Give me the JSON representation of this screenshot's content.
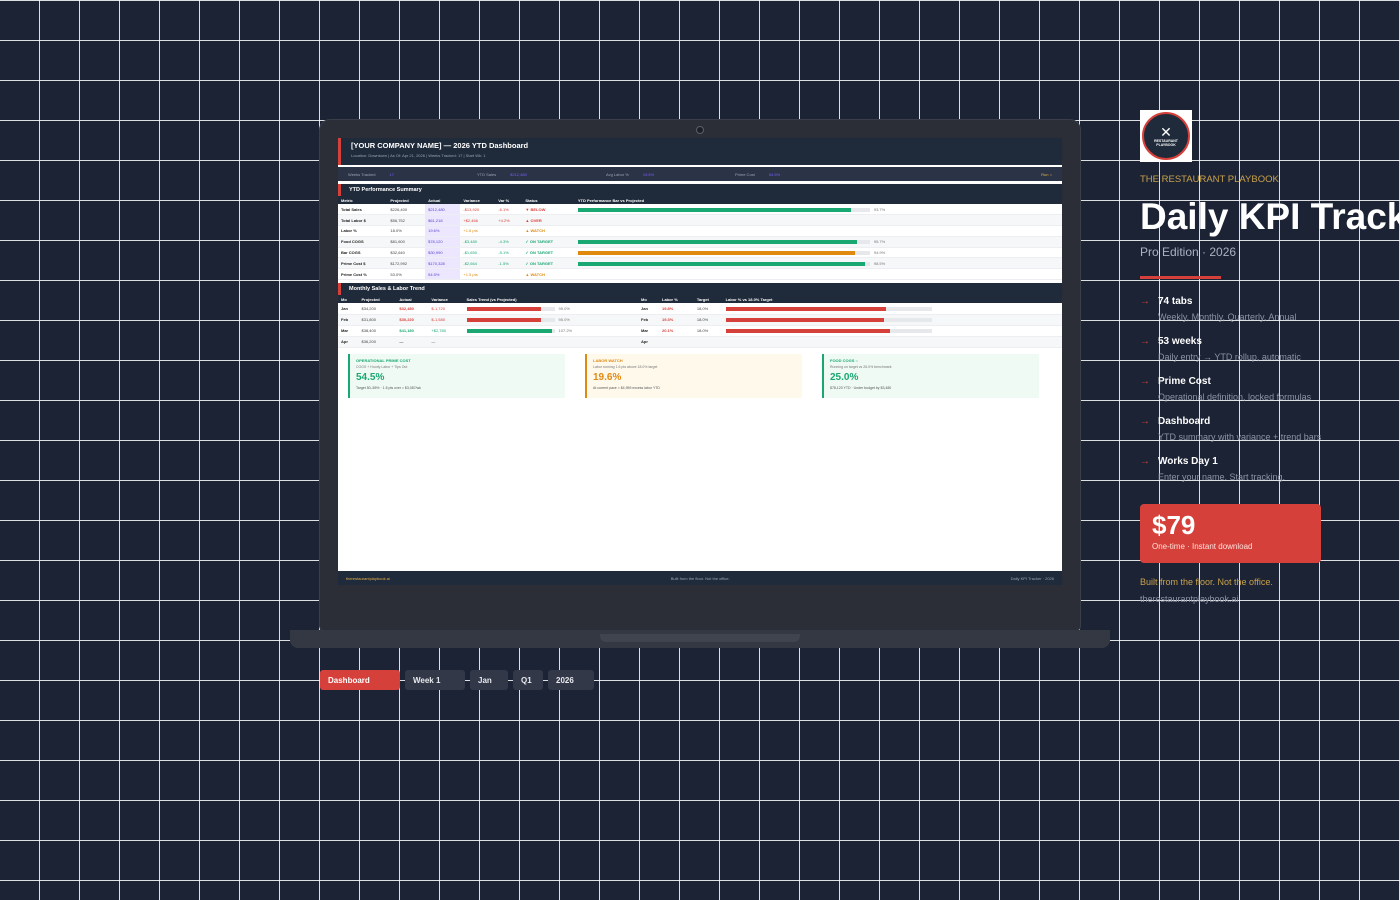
{
  "dashboard": {
    "title": "[YOUR COMPANY NAME]  —  2026 YTD Dashboard",
    "subtitle": "Location: Downtown  |  As Of: Apr 21, 2026  |  Weeks Tracked: 17  |  Start Wk: 1",
    "stats": [
      {
        "label": "Weeks Tracked",
        "value": "17"
      },
      {
        "label": "YTD Sales",
        "value": "$212,480"
      },
      {
        "label": "Avg Labor %",
        "value": "19.6%"
      },
      {
        "label": "Prime Cost",
        "value": "54.5%"
      }
    ],
    "stat_flag": "Run ○",
    "ytd_section": "YTD Performance Summary",
    "ytd_headers": [
      "Metric",
      "Projected",
      "Actual",
      "Variance",
      "Var %",
      "Status",
      "YTD Performance Bar vs Projected"
    ],
    "ytd_rows": [
      {
        "metric": "Total Sales",
        "projected": "$226,400",
        "actual": "$212,480",
        "variance": "-$13,920",
        "var_pct": "-6.1%",
        "status": "▼ BELOW",
        "bar_label": "93.7%",
        "bar": 0.937,
        "tone": "red",
        "bar_color": "#1aa872"
      },
      {
        "metric": "Total Labor $",
        "projected": "$56,752",
        "actual": "$61,218",
        "variance": "+$2,466",
        "var_pct": "+4.2%",
        "status": "▲ OVER",
        "bar_label": "",
        "bar": 0,
        "tone": "red",
        "bar_color": "#1aa872"
      },
      {
        "metric": "Labor %",
        "projected": "18.0%",
        "actual": "19.6%",
        "variance": "+1.6 pts",
        "var_pct": "",
        "status": "▲ WATCH",
        "bar_label": "",
        "bar": 0,
        "tone": "amber",
        "bar_color": "#1aa872"
      },
      {
        "metric": "Food COGS",
        "projected": "$81,600",
        "actual": "$78,120",
        "variance": "-$3,480",
        "var_pct": "-4.3%",
        "status": "✓ ON TARGET",
        "bar_label": "95.7%",
        "bar": 0.957,
        "tone": "green",
        "bar_color": "#1aa872"
      },
      {
        "metric": "Bar COGS",
        "projected": "$32,640",
        "actual": "$30,990",
        "variance": "-$1,650",
        "var_pct": "-5.1%",
        "status": "✓ ON TARGET",
        "bar_label": "94.9%",
        "bar": 0.949,
        "tone": "green",
        "bar_color": "#e08a10"
      },
      {
        "metric": "Prime Cost $",
        "projected": "$172,992",
        "actual": "$170,328",
        "variance": "-$2,664",
        "var_pct": "-1.5%",
        "status": "✓ ON TARGET",
        "bar_label": "98.5%",
        "bar": 0.985,
        "tone": "green",
        "bar_color": "#1aa872"
      },
      {
        "metric": "Prime Cost %",
        "projected": "53.0%",
        "actual": "54.5%",
        "variance": "+1.5 pts",
        "var_pct": "",
        "status": "▲ WATCH",
        "bar_label": "",
        "bar": 0,
        "tone": "amber",
        "bar_color": "#1aa872"
      }
    ],
    "monthly_section": "Monthly Sales & Labor Trend",
    "sales_headers": [
      "Mo",
      "Projected",
      "Actual",
      "Variance",
      "Sales Trend (vs Projected)"
    ],
    "sales_rows": [
      {
        "mo": "Jan",
        "projected": "$34,200",
        "actual": "$32,480",
        "variance": "$-1,720",
        "bar_label": "95.0%",
        "bar": 0.85,
        "bar_color": "#d6403a",
        "tone": "red"
      },
      {
        "mo": "Feb",
        "projected": "$31,800",
        "actual": "$30,220",
        "variance": "$-1,580",
        "bar_label": "95.0%",
        "bar": 0.85,
        "bar_color": "#d6403a",
        "tone": "red"
      },
      {
        "mo": "Mar",
        "projected": "$38,400",
        "actual": "$41,180",
        "variance": "+$2,780",
        "bar_label": "107.2%",
        "bar": 0.97,
        "bar_color": "#1aa872",
        "tone": "green"
      },
      {
        "mo": "Apr",
        "projected": "$36,200",
        "actual": "—",
        "variance": "—",
        "bar_label": "",
        "bar": 0,
        "bar_color": "#1aa872",
        "tone": "none"
      }
    ],
    "labor_headers": [
      "Mo",
      "Labor %",
      "Target",
      "Labor % vs 18.0% Target"
    ],
    "labor_rows": [
      {
        "mo": "Jan",
        "labor": "19.8%",
        "target": "18.0%",
        "bar": 0.78
      },
      {
        "mo": "Feb",
        "labor": "19.3%",
        "target": "18.0%",
        "bar": 0.77
      },
      {
        "mo": "Mar",
        "labor": "20.1%",
        "target": "18.0%",
        "bar": 0.8
      },
      {
        "mo": "Apr",
        "labor": "",
        "target": "",
        "bar": 0
      }
    ],
    "cards": [
      {
        "title": "OPERATIONAL PRIME COST",
        "desc": "COGS + Hourly Labor + Tips Out",
        "value": "54.5%",
        "foot": "Target 50–55%  ·  1.5 pts over = $3,087/wk",
        "color": "#1aa872",
        "bg": "#effaf4"
      },
      {
        "title": "LABOR WATCH",
        "desc": "Labor running 1.6 pts above 18.0% target",
        "value": "19.6%",
        "foot": "At current pace = $4,959 excess labor YTD",
        "color": "#e08a10",
        "bg": "#fff9ec"
      },
      {
        "title": "FOOD COGS ○",
        "desc": "Running on target vs 26.0% benchmark",
        "value": "25.0%",
        "foot": "$78,120 YTD  ·  Under budget by $3,480",
        "color": "#1aa872",
        "bg": "#effaf4"
      }
    ],
    "footer_left": "therestaurantplaybook.ai",
    "footer_center": "Built from the floor. Not the office.",
    "footer_right": "Daily KPI Tracker  ·  2026"
  },
  "tabs": [
    "Dashboard",
    "Week 1",
    "Jan",
    "Q1",
    "2026"
  ],
  "logo": {
    "line1": "RESTAURANT",
    "line2": "PLAYBOOK"
  },
  "panel": {
    "brand": "THE RESTAURANT PLAYBOOK",
    "title": "Daily KPI Tracker",
    "edition": "Pro Edition  ·  2026",
    "features": [
      {
        "title": "74 tabs",
        "desc": "Weekly, Monthly, Quarterly, Annual"
      },
      {
        "title": "53 weeks",
        "desc": "Daily entry  →  YTD rollup, automatic"
      },
      {
        "title": "Prime Cost",
        "desc": "Operational definition, locked formulas"
      },
      {
        "title": "Dashboard",
        "desc": "YTD summary with variance + trend bars"
      },
      {
        "title": "Works Day 1",
        "desc": "Enter your name. Start tracking."
      }
    ],
    "price": "$79",
    "price_sub": "One-time  ·  Instant download",
    "tagline": "Built from the floor. Not the office.",
    "site": "therestaurantplaybook.ai"
  },
  "colors": {
    "accent": "#d6403a",
    "green": "#1aa872",
    "amber": "#e08a10",
    "navy": "#1f2a3a",
    "gold": "#c9a24a"
  }
}
